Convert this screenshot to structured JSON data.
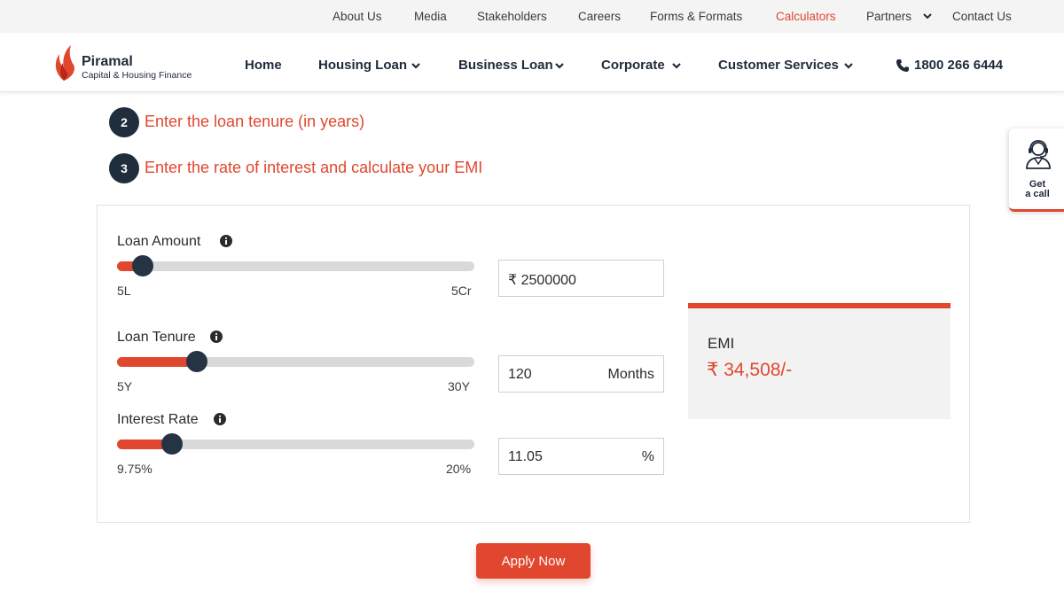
{
  "topbar": {
    "links": [
      "About Us",
      "Media",
      "Stakeholders",
      "Careers",
      "Forms & Formats",
      "Calculators",
      "Partners",
      "Contact Us"
    ],
    "active": "Calculators"
  },
  "brand": {
    "name": "Piramal",
    "tagline": "Capital & Housing Finance"
  },
  "nav": {
    "items": [
      "Home",
      "Housing Loan",
      "Business Loan",
      "Corporate",
      "Customer Services"
    ],
    "phone": "1800 266 6444"
  },
  "steps": [
    {
      "num": "2",
      "text": "Enter the loan tenure (in years)"
    },
    {
      "num": "3",
      "text": "Enter the rate of interest and calculate your EMI"
    }
  ],
  "calculator": {
    "loan_amount": {
      "label": "Loan Amount",
      "min_label": "5L",
      "max_label": "5Cr",
      "value_display": "₹ 2500000",
      "slider_fraction": 0.067
    },
    "loan_tenure": {
      "label": "Loan Tenure",
      "min_label": "5Y",
      "max_label": "30Y",
      "value_display": "120",
      "unit": "Months",
      "slider_fraction": 0.218
    },
    "interest_rate": {
      "label": "Interest Rate",
      "min_label": "9.75%",
      "max_label": "20%",
      "value_display": "11.05",
      "unit": "%",
      "slider_fraction": 0.149
    }
  },
  "emi": {
    "label": "EMI",
    "amount": "₹ 34,508/-"
  },
  "apply_label": "Apply Now",
  "get_call": {
    "line1": "Get",
    "line2": "a call"
  },
  "colors": {
    "accent": "#e0472e",
    "navy": "#1f2d3d",
    "track": "#d9d9d9"
  }
}
